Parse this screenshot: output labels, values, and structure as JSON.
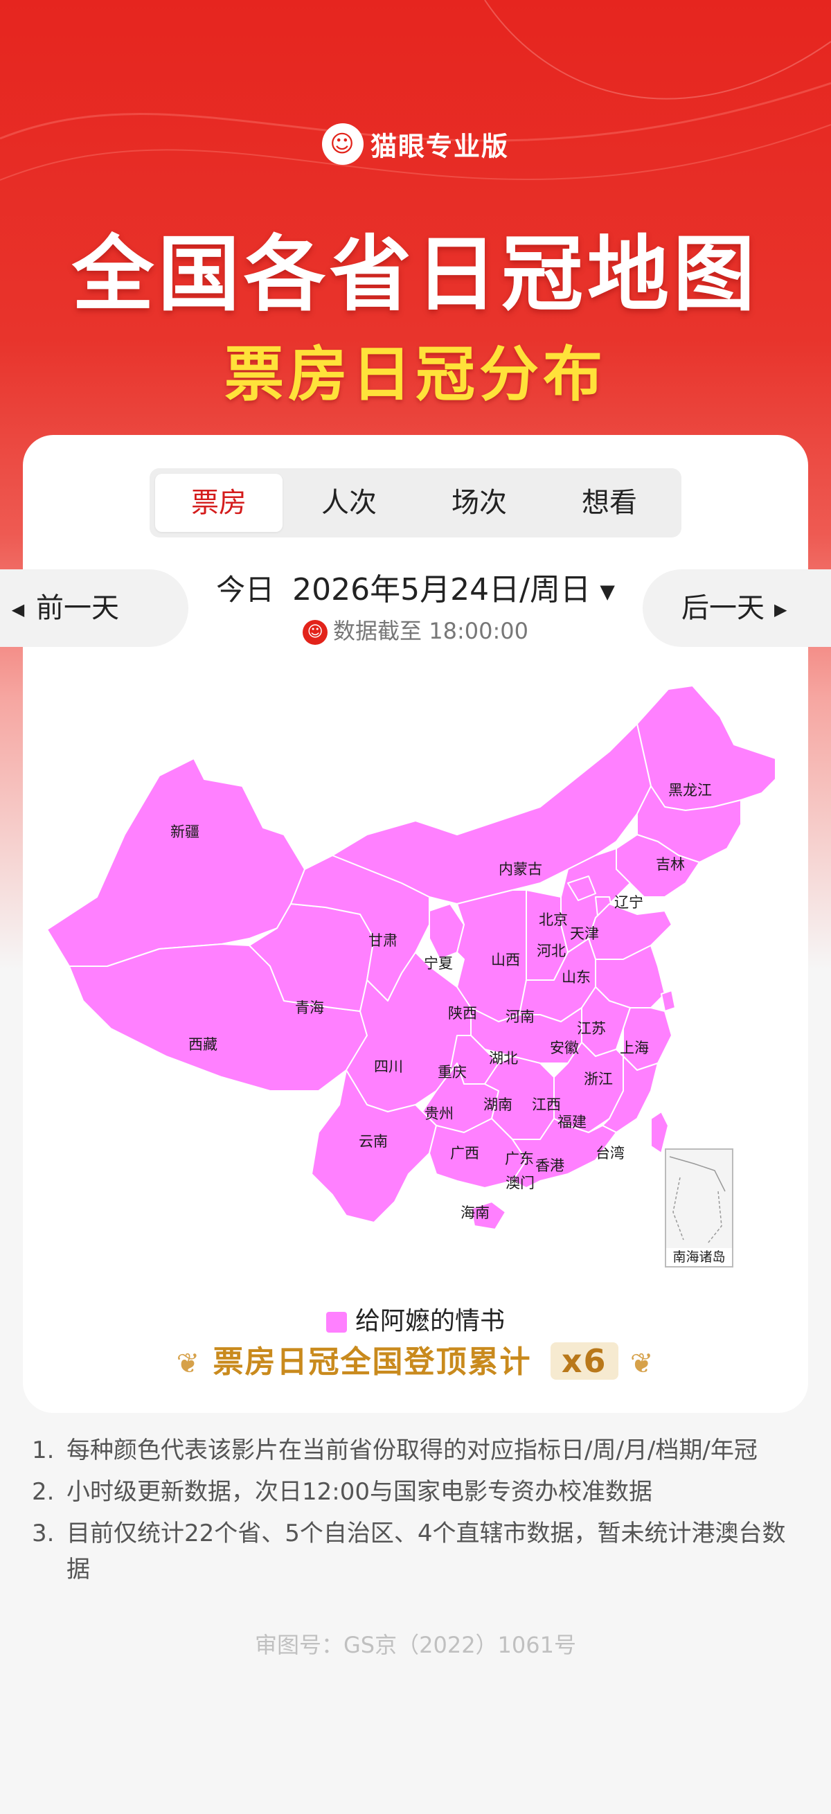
{
  "brand": {
    "name": "猫眼专业版",
    "logo_icon": "cat-face-icon"
  },
  "header": {
    "title": "全国各省日冠地图",
    "subtitle": "票房日冠分布"
  },
  "tabs": [
    {
      "label": "票房",
      "active": true
    },
    {
      "label": "人次",
      "active": false
    },
    {
      "label": "场次",
      "active": false
    },
    {
      "label": "想看",
      "active": false
    }
  ],
  "date_nav": {
    "prev_label": "前一天",
    "next_label": "后一天",
    "today_label": "今日",
    "date": "2026年5月24日/周日",
    "cutoff": "数据截至 18:00:00"
  },
  "map": {
    "fill_color": "#ff80ff",
    "provinces": [
      "新疆",
      "西藏",
      "青海",
      "甘肃",
      "内蒙古",
      "黑龙江",
      "吉林",
      "辽宁",
      "北京",
      "天津",
      "河北",
      "山西",
      "宁夏",
      "陕西",
      "山东",
      "河南",
      "江苏",
      "上海",
      "安徽",
      "湖北",
      "四川",
      "重庆",
      "浙江",
      "贵州",
      "湖南",
      "江西",
      "福建",
      "云南",
      "广西",
      "广东",
      "香港",
      "澳门",
      "台湾",
      "海南"
    ],
    "inset_label": "南海诸岛"
  },
  "legend": {
    "film": "给阿嬷的情书",
    "color": "#ff80ff"
  },
  "champion": {
    "text": "票房日冠全国登顶累计",
    "times": "x6"
  },
  "notes": [
    {
      "num": "1.",
      "text": "每种颜色代表该影片在当前省份取得的对应指标日/周/月/档期/年冠"
    },
    {
      "num": "2.",
      "text": "小时级更新数据，次日12:00与国家电影专资办校准数据"
    },
    {
      "num": "3.",
      "text": "目前仅统计22个省、5个自治区、4个直辖市数据，暂未统计港澳台数据"
    }
  ],
  "approval": "审图号：GS京（2022）1061号"
}
